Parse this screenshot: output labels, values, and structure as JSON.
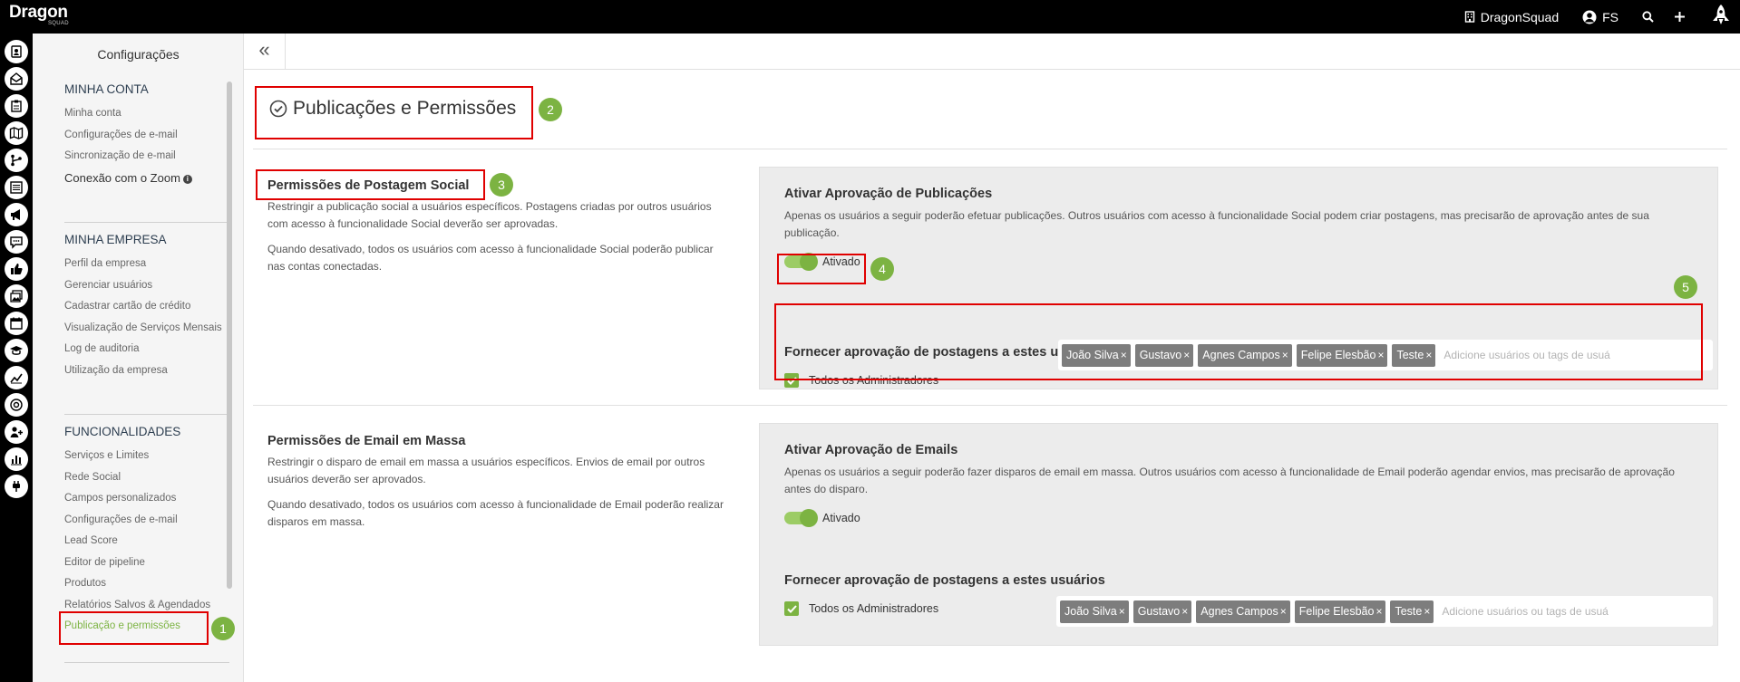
{
  "topbar": {
    "logo": "Dragon",
    "logo_sub": "SQUAD",
    "company": "DragonSquad",
    "user": "FS"
  },
  "rail": {
    "icons": [
      "contacts-icon",
      "inbox-icon",
      "clipboard-icon",
      "map-icon",
      "pipeline-icon",
      "list-icon",
      "megaphone-icon",
      "chat-icon",
      "thumbs-up-icon",
      "gallery-icon",
      "calendar-icon",
      "graduation-icon",
      "trend-icon",
      "support-icon",
      "user-add-icon",
      "bar-chart-icon",
      "plug-icon"
    ]
  },
  "sidebar": {
    "title": "Configurações",
    "sections": [
      {
        "header": "MINHA CONTA",
        "items": [
          "Minha conta",
          "Configurações de e-mail",
          "Sincronização de e-mail",
          "Conexão com o Zoom"
        ]
      },
      {
        "header": "MINHA EMPRESA",
        "items": [
          "Perfil da empresa",
          "Gerenciar usuários",
          "Cadastrar cartão de crédito",
          "Visualização de Serviços Mensais",
          "Log de auditoria",
          "Utilização da empresa"
        ]
      },
      {
        "header": "FUNCIONALIDADES",
        "items": [
          "Serviços e Limites",
          "Rede Social",
          "Campos personalizados",
          "Configurações de e-mail",
          "Lead Score",
          "Editor de pipeline",
          "Produtos",
          "Relatórios Salvos & Agendados",
          "Publicação e permissões"
        ]
      }
    ]
  },
  "main": {
    "collapse_label": "«",
    "title": "Publicações e Permissões",
    "social": {
      "heading": "Permissões de Postagem Social",
      "desc1": "Restringir a publicação social a usuários específicos. Postagens criadas por outros usuários com acesso à funcionalidade Social deverão ser aprovadas.",
      "desc2": "Quando desativado, todos os usuários com acesso à funcionalidade Social poderão publicar nas contas conectadas.",
      "panel_title": "Ativar Aprovação de Publicações",
      "panel_desc": "Apenas os usuários a seguir poderão efetuar publicações. Outros usuários com acesso à funcionalidade Social podem criar postagens, mas precisarão de aprovação antes de sua publicação.",
      "toggle_label": "Ativado",
      "approvers_title": "Fornecer aprovação de postagens a estes usuários",
      "checkbox_label": "Todos os Administradores",
      "tags": [
        "João Silva",
        "Gustavo",
        "Agnes Campos",
        "Felipe Elesbão",
        "Teste"
      ],
      "placeholder": "Adicione usuários ou tags de usuá"
    },
    "email": {
      "heading": "Permissões de Email em Massa",
      "desc1": "Restringir o disparo de email em massa a usuários específicos. Envios de email por outros usuários deverão ser aprovados.",
      "desc2": "Quando desativado, todos os usuários com acesso à funcionalidade de Email poderão realizar disparos em massa.",
      "panel_title": "Ativar Aprovação de Emails",
      "panel_desc": "Apenas os usuários a seguir poderão fazer disparos de email em massa. Outros usuários com acesso à funcionalidade de Email poderão agendar envios, mas precisarão de aprovação antes do disparo.",
      "toggle_label": "Ativado",
      "approvers_title": "Fornecer aprovação de postagens a estes usuários",
      "checkbox_label": "Todos os Administradores",
      "tags": [
        "João Silva",
        "Gustavo",
        "Agnes Campos",
        "Felipe Elesbão",
        "Teste"
      ],
      "placeholder": "Adicione usuários ou tags de usuá"
    }
  },
  "annotations": [
    "1",
    "2",
    "3",
    "4",
    "5"
  ],
  "colors": {
    "accent": "#7cb342",
    "highlight": "#e00000",
    "topbar": "#000000"
  }
}
